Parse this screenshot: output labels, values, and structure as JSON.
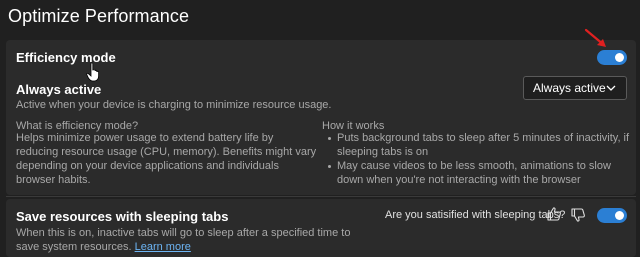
{
  "page": {
    "title": "Optimize Performance"
  },
  "efficiency": {
    "label": "Efficiency mode",
    "toggle_on": true,
    "always_active": {
      "label": "Always active",
      "description": "Active when your device is charging to minimize resource usage.",
      "dropdown_value": "Always active"
    },
    "what_is": {
      "heading": "What is efficiency mode?",
      "body": "Helps minimize power usage to extend battery life by reducing resource usage (CPU, memory). Benefits might vary depending on your device applications and individuals browser habits."
    },
    "how_it_works": {
      "heading": "How it works",
      "items": [
        "Puts background tabs to sleep after 5 minutes of inactivity, if sleeping tabs is on",
        "May cause videos to be less smooth, animations to slow down when you're not interacting with the browser"
      ]
    }
  },
  "sleeping_tabs": {
    "label": "Save resources with sleeping tabs",
    "description": "When this is on, inactive tabs will go to sleep after a specified time to save system resources.",
    "link_text": "Learn more",
    "survey_question": "Are you satisified with sleeping tabs?",
    "toggle_on": true
  },
  "icons": {
    "thumbs_up": "thumbs-up-icon",
    "thumbs_down": "thumbs-down-icon",
    "chevron": "chevron-down-icon",
    "cursor": "hand-cursor-icon",
    "annotation_arrow": "red-arrow-icon"
  },
  "colors": {
    "background": "#202020",
    "card": "#2b2b2b",
    "accent": "#2b7fd4",
    "link": "#6cb4f4",
    "annotation": "#e02020"
  }
}
